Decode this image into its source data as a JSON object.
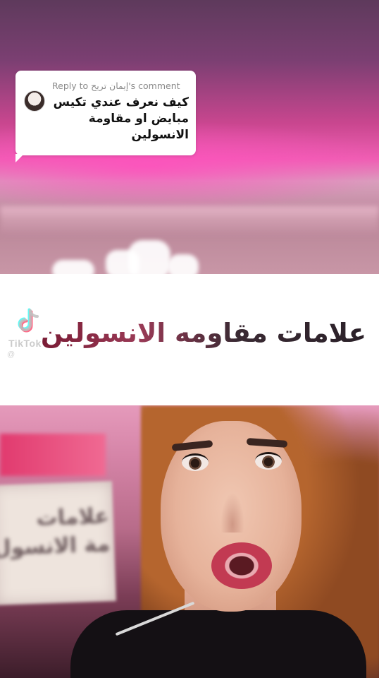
{
  "reply": {
    "header": "Reply to إيمان تريح's comment",
    "comment_text": "كيف نعرف عندي تكيس مبايض او مقاومة الانسولين"
  },
  "overlay": {
    "title": "علامات مقاومه الانسولين"
  },
  "watermark": {
    "brand": "TikTok",
    "username": "@"
  },
  "background_sign": {
    "line1": "علامات",
    "line2": "مة الانسول"
  },
  "colors": {
    "bubble_bg": "#ffffff",
    "band_bg": "#ffffff",
    "title_dark": "#2a2028",
    "title_accent": "#7a1c35",
    "tiktok_cyan": "#25f4ee",
    "tiktok_red": "#fe2c55"
  },
  "icons": {
    "tiktok": "tiktok-note-icon",
    "avatar": "commenter-avatar"
  }
}
